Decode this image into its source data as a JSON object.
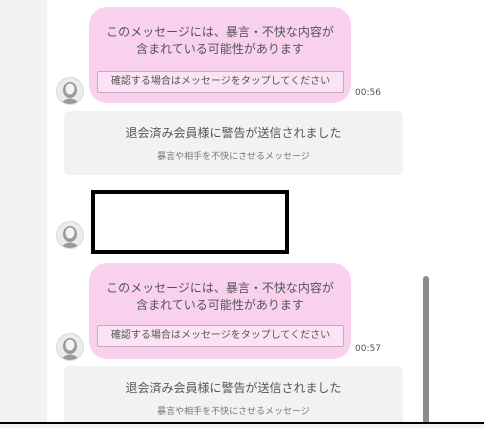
{
  "chat": {
    "messages": [
      {
        "type": "filtered",
        "text": "このメッセージには、暴言・不快な内容が\n含まれている可能性があります",
        "button": "確認する場合はメッセージをタップしてください",
        "time": "00:56"
      },
      {
        "type": "notice",
        "title": "退会済み会員様に警告が送信されました",
        "subtitle": "暴言や相手を不快にさせるメッセージ"
      },
      {
        "type": "redacted"
      },
      {
        "type": "filtered",
        "text": "このメッセージには、暴言・不快な内容が\n含まれている可能性があります",
        "button": "確認する場合はメッセージをタップしてください",
        "time": "00:57"
      },
      {
        "type": "notice",
        "title": "退会済み会員様に警告が送信されました",
        "subtitle": "暴言や相手を不快にさせるメッセージ"
      }
    ]
  },
  "colors": {
    "bubble": "#f9d1ee",
    "notice": "#f2f2f2",
    "scrollbar": "#8b8b8b"
  }
}
